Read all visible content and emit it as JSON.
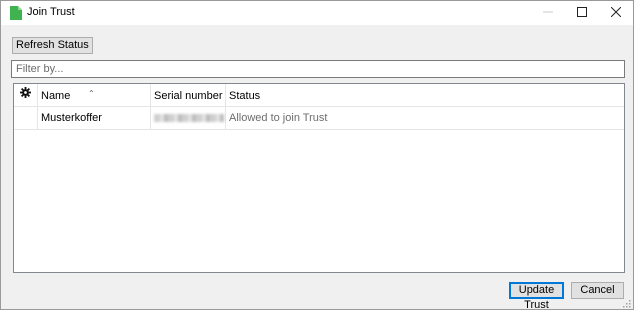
{
  "window": {
    "title": "Join Trust",
    "app_icon": "green-document-icon",
    "controls": {
      "minimize_icon": "minimize-icon",
      "maximize_icon": "maximize-icon",
      "close_icon": "close-icon"
    }
  },
  "toolbar": {
    "refresh_label": "Refresh Status"
  },
  "filter": {
    "placeholder": "Filter by...",
    "value": ""
  },
  "table": {
    "columns": {
      "settings_icon": "gear-icon",
      "name": "Name",
      "serial": "Serial number",
      "status": "Status"
    },
    "sort": {
      "column": "Name",
      "direction": "ascending"
    },
    "rows": [
      {
        "name": "Musterkoffer",
        "serial_redacted": true,
        "status": "Allowed to join Trust"
      }
    ]
  },
  "footer": {
    "update_label": "Update Trust",
    "cancel_label": "Cancel"
  },
  "colors": {
    "accent": "#0078d7",
    "app_icon_green": "#3fb34f",
    "status_text": "#6d6d6d"
  }
}
